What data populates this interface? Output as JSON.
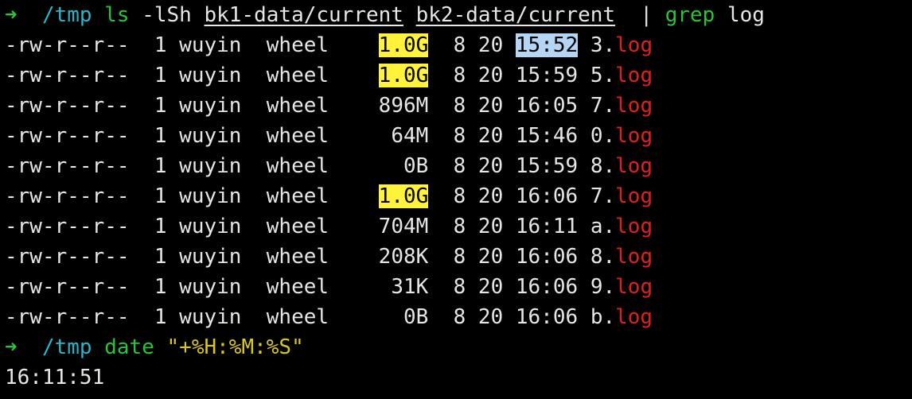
{
  "colors": {
    "background": "#000000",
    "text": "#e6e6e6",
    "prompt_arrow": "#28c43a",
    "cwd": "#2ab6c9",
    "grep_match": "#e02020",
    "size_highlight": "#fff23a",
    "selection_highlight": "#b5d5f5"
  },
  "prompt1": {
    "arrow": "➜",
    "cwd": "/tmp",
    "cmd": "ls",
    "flags": "-lSh",
    "path1": "bk1-data/current",
    "path2": "bk2-data/current",
    "pipe": "|",
    "grep": "grep",
    "pattern": "log"
  },
  "rows": [
    {
      "perms": "-rw-r--r--",
      "links": "1",
      "user": "wuyin",
      "group": "wheel",
      "size": "1.0G",
      "month": "8",
      "day": "20",
      "time": "15:52",
      "name_prefix": "3.",
      "ext": "log",
      "size_hl": true,
      "time_hl": true
    },
    {
      "perms": "-rw-r--r--",
      "links": "1",
      "user": "wuyin",
      "group": "wheel",
      "size": "1.0G",
      "month": "8",
      "day": "20",
      "time": "15:59",
      "name_prefix": "5.",
      "ext": "log",
      "size_hl": true,
      "time_hl": false
    },
    {
      "perms": "-rw-r--r--",
      "links": "1",
      "user": "wuyin",
      "group": "wheel",
      "size": "896M",
      "month": "8",
      "day": "20",
      "time": "16:05",
      "name_prefix": "7.",
      "ext": "log",
      "size_hl": false,
      "time_hl": false
    },
    {
      "perms": "-rw-r--r--",
      "links": "1",
      "user": "wuyin",
      "group": "wheel",
      "size": "64M",
      "month": "8",
      "day": "20",
      "time": "15:46",
      "name_prefix": "0.",
      "ext": "log",
      "size_hl": false,
      "time_hl": false
    },
    {
      "perms": "-rw-r--r--",
      "links": "1",
      "user": "wuyin",
      "group": "wheel",
      "size": "0B",
      "month": "8",
      "day": "20",
      "time": "15:59",
      "name_prefix": "8.",
      "ext": "log",
      "size_hl": false,
      "time_hl": false
    },
    {
      "perms": "-rw-r--r--",
      "links": "1",
      "user": "wuyin",
      "group": "wheel",
      "size": "1.0G",
      "month": "8",
      "day": "20",
      "time": "16:06",
      "name_prefix": "7.",
      "ext": "log",
      "size_hl": true,
      "time_hl": false
    },
    {
      "perms": "-rw-r--r--",
      "links": "1",
      "user": "wuyin",
      "group": "wheel",
      "size": "704M",
      "month": "8",
      "day": "20",
      "time": "16:11",
      "name_prefix": "a.",
      "ext": "log",
      "size_hl": false,
      "time_hl": false
    },
    {
      "perms": "-rw-r--r--",
      "links": "1",
      "user": "wuyin",
      "group": "wheel",
      "size": "208K",
      "month": "8",
      "day": "20",
      "time": "16:06",
      "name_prefix": "8.",
      "ext": "log",
      "size_hl": false,
      "time_hl": false
    },
    {
      "perms": "-rw-r--r--",
      "links": "1",
      "user": "wuyin",
      "group": "wheel",
      "size": "31K",
      "month": "8",
      "day": "20",
      "time": "16:06",
      "name_prefix": "9.",
      "ext": "log",
      "size_hl": false,
      "time_hl": false
    },
    {
      "perms": "-rw-r--r--",
      "links": "1",
      "user": "wuyin",
      "group": "wheel",
      "size": "0B",
      "month": "8",
      "day": "20",
      "time": "16:06",
      "name_prefix": "b.",
      "ext": "log",
      "size_hl": false,
      "time_hl": false
    }
  ],
  "prompt2": {
    "arrow": "➜",
    "cwd": "/tmp",
    "cmd": "date",
    "arg": "\"+%H:%M:%S\""
  },
  "output": "16:11:51"
}
